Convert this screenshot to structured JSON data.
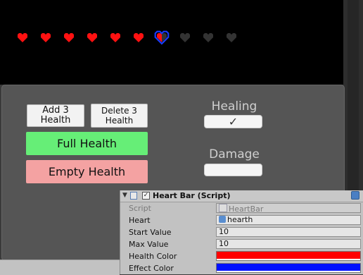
{
  "hearts": {
    "total": 10,
    "full": 6,
    "selected_index": 6,
    "full_color": "#ff1111",
    "empty_color": "#333333",
    "selected_outline_color": "#1a3cff"
  },
  "panel": {
    "add_label": "Add 3 Health",
    "delete_label": "Delete 3 Health",
    "full_label": "Full Health",
    "empty_label": "Empty Health",
    "healing_label": "Healing",
    "healing_check": "✓",
    "damage_label": "Damage"
  },
  "inspector": {
    "title": "Heart Bar (Script)",
    "rows": {
      "script": {
        "label": "Script",
        "value": "HeartBar"
      },
      "heart": {
        "label": "Heart",
        "value": "hearth"
      },
      "start": {
        "label": "Start Value",
        "value": "10"
      },
      "max": {
        "label": "Max Value",
        "value": "10"
      },
      "health_color": {
        "label": "Health Color",
        "color": "#ff0000"
      },
      "effect_color": {
        "label": "Effect Color",
        "color": "#0010ff"
      }
    }
  }
}
